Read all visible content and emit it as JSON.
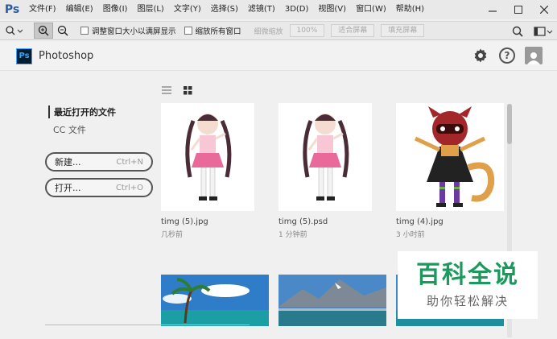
{
  "menubar": {
    "logo": "Ps",
    "items": [
      "文件(F)",
      "编辑(E)",
      "图像(I)",
      "图层(L)",
      "文字(Y)",
      "选择(S)",
      "滤镜(T)",
      "3D(D)",
      "视图(V)",
      "窗口(W)",
      "帮助(H)"
    ],
    "controls": [
      "minimize-icon",
      "maximize-icon",
      "close-icon"
    ]
  },
  "options": {
    "resize_windows": "调整窗口大小以满屏显示",
    "zoom_all": "缩放所有窗口",
    "scrubby_zoom": "细微缩放",
    "zoom_pct": "100%",
    "fit_screen": "适合屏幕",
    "fill_screen": "填充屏幕"
  },
  "header": {
    "badge": "Ps",
    "app_name": "Photoshop",
    "help": "?"
  },
  "nav": {
    "recent": "最近打开的文件",
    "cc_files": "CC 文件",
    "new_label": "新建...",
    "new_shortcut": "Ctrl+N",
    "open_label": "打开...",
    "open_shortcut": "Ctrl+O"
  },
  "files": [
    {
      "name": "timg (5).jpg",
      "time": "几秒前"
    },
    {
      "name": "timg (5).psd",
      "time": "1 分钟前"
    },
    {
      "name": "timg (4).jpg",
      "time": "3 小时前"
    }
  ],
  "watermark": {
    "title": "百科全说",
    "subtitle": "助你轻松解决"
  },
  "colors": {
    "ps_blue": "#31a8ff",
    "ps_dark": "#001d34",
    "watermark_green": "#1a9a5c"
  }
}
